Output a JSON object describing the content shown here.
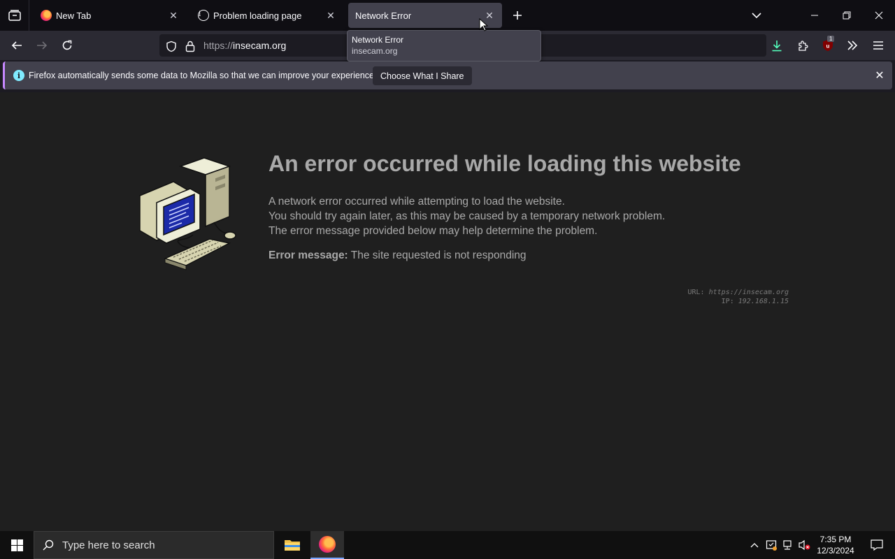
{
  "browser": {
    "tabs": [
      {
        "title": "New Tab",
        "favicon": "firefox-icon"
      },
      {
        "title": "Problem loading page",
        "favicon": "info-icon"
      },
      {
        "title": "Network Error",
        "favicon": "none",
        "active": true
      }
    ],
    "url": {
      "scheme": "https://",
      "host": "insecam.org"
    },
    "tooltip": {
      "title": "Network Error",
      "subtitle": "insecam.org"
    },
    "extension_badge": "1",
    "accent_color": "#c688ff"
  },
  "notification": {
    "text": "Firefox automatically sends some data to Mozilla so that we can improve your experience.",
    "button_label": "Choose What I Share"
  },
  "error_page": {
    "title": "An error occurred while loading this website",
    "description": [
      "A network error occurred while attempting to load the website.",
      "You should try again later, as this may be caused by a temporary network problem.",
      "The error message provided below may help determine the problem."
    ],
    "message_label": "Error message:",
    "message_value": " The site requested is not responding",
    "url_label": "URL:",
    "url_value": "https://insecam.org",
    "ip_label": "IP:",
    "ip_value": "192.168.1.15"
  },
  "taskbar": {
    "search_placeholder": "Type here to search",
    "time": "7:35 PM",
    "date": "12/3/2024"
  }
}
